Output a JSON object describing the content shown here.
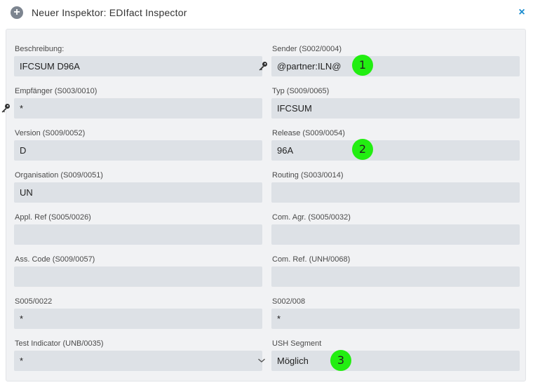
{
  "dialog": {
    "title": "Neuer Inspektor: EDIfact Inspector",
    "close_label": "×",
    "add_icon_label": "+"
  },
  "fields": [
    {
      "label": "Beschreibung:",
      "value": ""
    },
    {
      "label": "Sender (S002/0004)",
      "value": "@partner:ILN@"
    },
    {
      "label": "Empfänger (S003/0010)",
      "value": "*"
    },
    {
      "label": "Typ (S009/0065)",
      "value": "IFCSUM"
    },
    {
      "label": "Version (S009/0052)",
      "value": "D"
    },
    {
      "label": "Release (S009/0054)",
      "value": "96A"
    },
    {
      "label": "Organisation (S009/0051)",
      "value": "UN"
    },
    {
      "label": "Routing (S003/0014)",
      "value": ""
    },
    {
      "label": "Appl. Ref (S005/0026)",
      "value": ""
    },
    {
      "label": "Com. Agr. (S005/0032)",
      "value": ""
    },
    {
      "label": "Ass. Code (S009/0057)",
      "value": ""
    },
    {
      "label": "Com. Ref. (UNH/0068)",
      "value": ""
    },
    {
      "label": "S005/0022",
      "value": "*"
    },
    {
      "label": "S002/008",
      "value": "*"
    },
    {
      "label": "Test Indicator (UNB/0035)",
      "value": "*"
    },
    {
      "label": "USH Segment",
      "value": "Möglich"
    }
  ],
  "beschreibung_value": "IFCSUM D96A",
  "markers": [
    "1",
    "2",
    "3"
  ],
  "colors": {
    "marker": "#22ee11",
    "accent": "#1a8ccf",
    "field_bg": "#dde1e6"
  }
}
